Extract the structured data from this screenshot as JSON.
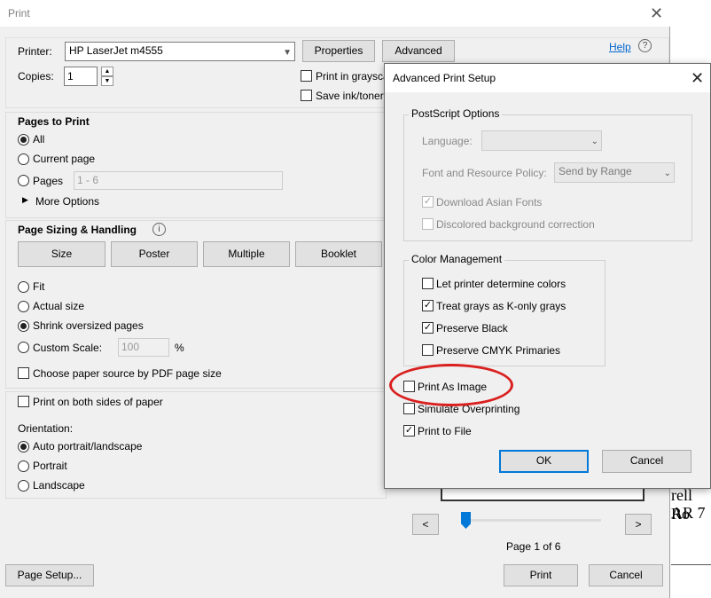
{
  "window": {
    "title": "Print"
  },
  "printer": {
    "label": "Printer:",
    "selected": "HP LaserJet m4555",
    "properties_btn": "Properties",
    "advanced_btn": "Advanced",
    "help_link": "Help"
  },
  "copies": {
    "label": "Copies:",
    "value": "1"
  },
  "options": {
    "grayscale": "Print in graysca",
    "save_ink": "Save ink/toner"
  },
  "pages_to_print": {
    "heading": "Pages to Print",
    "all": "All",
    "current": "Current page",
    "pages": "Pages",
    "pages_value": "1 - 6",
    "more_options": "More Options"
  },
  "page_sizing": {
    "heading": "Page Sizing & Handling",
    "tabs": [
      "Size",
      "Poster",
      "Multiple",
      "Booklet"
    ],
    "fit": "Fit",
    "actual_size": "Actual size",
    "shrink": "Shrink oversized pages",
    "custom_scale": "Custom Scale:",
    "custom_scale_value": "100",
    "percent": "%",
    "paper_source": "Choose paper source by PDF page size"
  },
  "duplex": {
    "label": "Print on both sides of paper"
  },
  "orientation": {
    "heading": "Orientation:",
    "auto": "Auto portrait/landscape",
    "portrait": "Portrait",
    "landscape": "Landscape"
  },
  "preview": {
    "prev": "<",
    "next": ">",
    "page_info": "Page 1 of 6",
    "slider_position": 0,
    "bg_text_1": "rell Ro",
    "bg_text_2": "AR 7"
  },
  "footer": {
    "page_setup": "Page Setup...",
    "print": "Print",
    "cancel": "Cancel"
  },
  "advanced_dialog": {
    "title": "Advanced Print Setup",
    "postscript": {
      "legend": "PostScript Options",
      "language_label": "Language:",
      "language_value": "",
      "font_policy_label": "Font and Resource Policy:",
      "font_policy_value": "Send by Range",
      "download_asian": "Download Asian Fonts",
      "discolored": "Discolored background correction"
    },
    "color_mgmt": {
      "legend": "Color Management",
      "let_printer": "Let printer determine colors",
      "treat_grays": "Treat grays as K-only grays",
      "preserve_black": "Preserve Black",
      "preserve_cmyk": "Preserve CMYK Primaries"
    },
    "print_as_image": "Print As Image",
    "simulate_overprinting": "Simulate Overprinting",
    "print_to_file": "Print to File",
    "ok": "OK",
    "cancel": "Cancel"
  },
  "colors": {
    "accent": "#0078d7",
    "highlight_annotation": "#d9201f",
    "link": "#0066cc"
  }
}
